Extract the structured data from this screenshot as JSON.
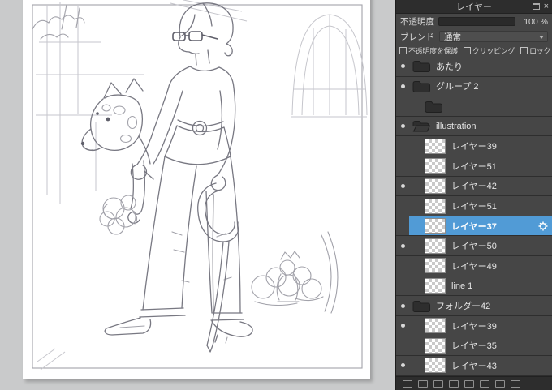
{
  "panel": {
    "title": "レイヤー",
    "opacity": {
      "label": "不透明度",
      "value": 100,
      "display": "100 %"
    },
    "blend": {
      "label": "ブレンド",
      "selected": "通常"
    },
    "options": [
      {
        "label": "不透明度を保護",
        "checked": false
      },
      {
        "label": "クリッピング",
        "checked": false
      },
      {
        "label": "ロック",
        "checked": false
      }
    ],
    "layers": [
      {
        "name": "あたり",
        "type": "folder",
        "visible": true,
        "indent": 0,
        "selected": false
      },
      {
        "name": "グループ 2",
        "type": "folder",
        "visible": true,
        "indent": 0,
        "selected": false
      },
      {
        "name": "",
        "type": "folder",
        "visible": false,
        "indent": 1,
        "selected": false
      },
      {
        "name": "illustration",
        "type": "folder-open",
        "visible": true,
        "indent": 0,
        "selected": false
      },
      {
        "name": "レイヤー39",
        "type": "layer",
        "visible": false,
        "indent": 1,
        "selected": false
      },
      {
        "name": "レイヤー51",
        "type": "layer",
        "visible": false,
        "indent": 1,
        "selected": false
      },
      {
        "name": "レイヤー42",
        "type": "layer",
        "visible": true,
        "indent": 1,
        "selected": false
      },
      {
        "name": "レイヤー51",
        "type": "layer",
        "visible": false,
        "indent": 1,
        "selected": false
      },
      {
        "name": "レイヤー37",
        "type": "layer",
        "visible": false,
        "indent": 1,
        "selected": true
      },
      {
        "name": "レイヤー50",
        "type": "layer",
        "visible": true,
        "indent": 1,
        "selected": false
      },
      {
        "name": "レイヤー49",
        "type": "layer",
        "visible": false,
        "indent": 1,
        "selected": false
      },
      {
        "name": "line 1",
        "type": "layer",
        "visible": false,
        "indent": 1,
        "selected": false
      },
      {
        "name": "フォルダー42",
        "type": "folder",
        "visible": true,
        "indent": 0,
        "selected": false
      },
      {
        "name": "レイヤー39",
        "type": "layer",
        "visible": true,
        "indent": 1,
        "selected": false
      },
      {
        "name": "レイヤー35",
        "type": "layer",
        "visible": false,
        "indent": 1,
        "selected": false
      },
      {
        "name": "レイヤー43",
        "type": "layer",
        "visible": true,
        "indent": 1,
        "selected": false
      }
    ],
    "bottom_icons": [
      "new-layer-icon",
      "new-folder-icon",
      "duplicate-layer-icon",
      "merge-down-icon",
      "move-up-icon",
      "move-down-icon",
      "clear-layer-icon",
      "delete-layer-icon"
    ],
    "accent_color": "#519bd6"
  }
}
